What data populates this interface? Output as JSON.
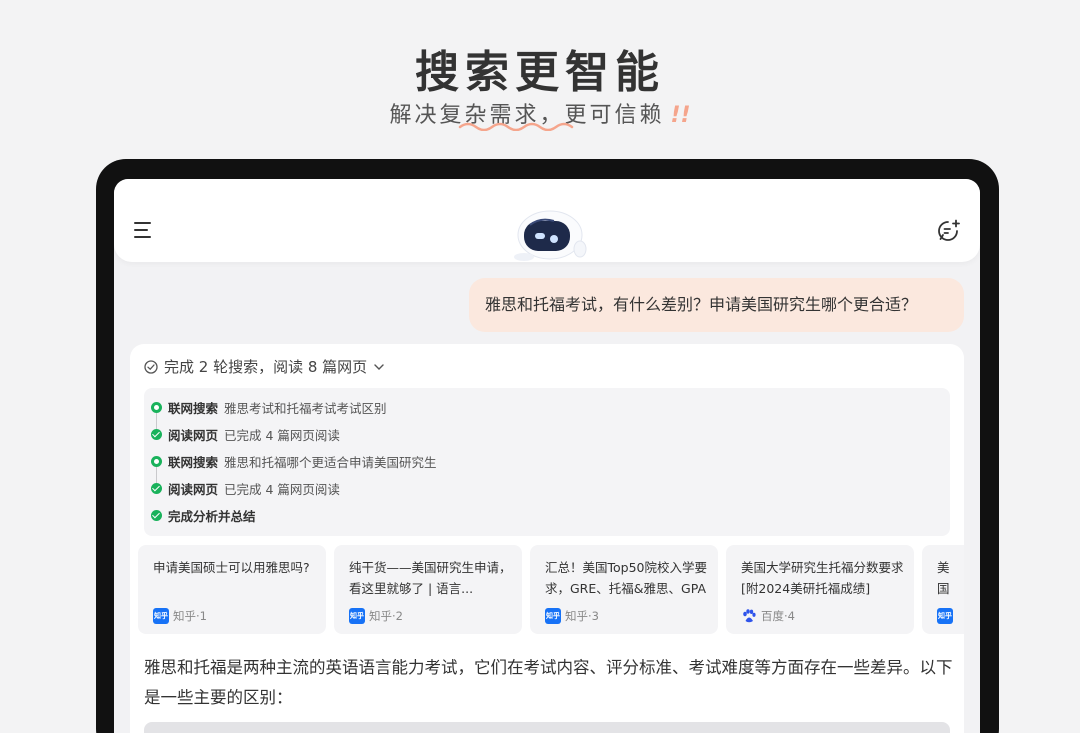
{
  "hero": {
    "title": "搜索更智能",
    "subtitle": "解决复杂需求，更可信赖",
    "bangs": "!!"
  },
  "colors": {
    "accent_orange": "#f5a58c",
    "user_bubble": "#fbe8de",
    "success_green": "#19b25b",
    "zhihu_blue": "#1772f6",
    "baidu_blue": "#2f54eb"
  },
  "topbar": {
    "menu_icon": "hamburger-icon",
    "logo_icon": "mascot-robot-icon",
    "new_chat_icon": "new-chat-icon"
  },
  "user_message": "雅思和托福考试，有什么差别？申请美国研究生哪个更合适？",
  "search_summary": {
    "text": "完成 2 轮搜索，阅读 8 篇网页",
    "chevron_icon": "chevron-down-icon"
  },
  "steps": [
    {
      "label": "联网搜索",
      "detail": "雅思考试和托福考试考试区别",
      "icon": "ring"
    },
    {
      "label": "阅读网页",
      "detail": "已完成 4 篇网页阅读",
      "icon": "tick"
    },
    {
      "label": "联网搜索",
      "detail": "雅思和托福哪个更适合申请美国研究生",
      "icon": "ring"
    },
    {
      "label": "阅读网页",
      "detail": "已完成 4 篇网页阅读",
      "icon": "tick"
    },
    {
      "label": "完成分析并总结",
      "detail": "",
      "icon": "tick"
    }
  ],
  "sources": [
    {
      "title": "申请美国硕士可以用雅思吗?",
      "site": "知乎·1",
      "badge": "知乎"
    },
    {
      "title": "纯干货——美国研究生申请，看这里就够了 | 语言...",
      "site": "知乎·2",
      "badge": "知乎"
    },
    {
      "title": "汇总！美国Top50院校入学要求，GRE、托福&雅思、GPA",
      "site": "知乎·3",
      "badge": "知乎"
    },
    {
      "title": "美国大学研究生托福分数要求[附2024美研托福成绩]",
      "site": "百度·4",
      "badge": "baidu"
    },
    {
      "title": "美国多分",
      "site": "",
      "badge": "知乎"
    }
  ],
  "answer": {
    "text": "雅思和托福是两种主流的英语语言能力考试，它们在考试内容、评分标准、考试难度等方面存在一些差异。以下是一些主要的区别："
  }
}
